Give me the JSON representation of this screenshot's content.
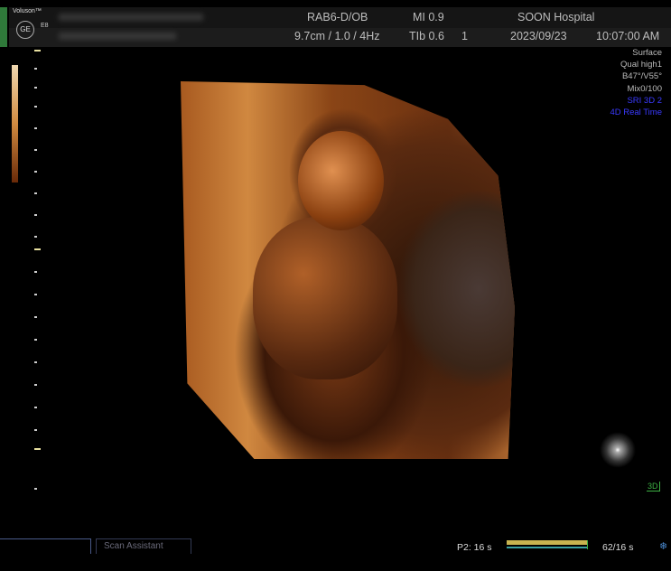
{
  "header": {
    "brand": "Voluson™",
    "logo": "GE",
    "model": "E8",
    "probe": "RAB6-D/OB",
    "mi": "MI 0.9",
    "hospital": "SOON Hospital",
    "depth_settings": "9.7cm / 1.0 /  4Hz",
    "tib": "TIb 0.6",
    "tib_index": "1",
    "date": "2023/09/23",
    "time": "10:07:00 AM"
  },
  "params": [
    "Surface",
    "Qual high1",
    "B47°/V55°",
    "Mix0/100"
  ],
  "params_blue": [
    "SRI 3D 2",
    "4D Real Time"
  ],
  "mode_badge": "3D",
  "tabs": {
    "scan_assistant": "Scan Assistant"
  },
  "cine": {
    "label": "P2:  16 s",
    "frames": "62/16 s",
    "progress": 1.0
  },
  "colors": {
    "accent_green": "#3cb043",
    "blue_text": "#3a3aff",
    "cine_yellow": "#c8b450"
  }
}
